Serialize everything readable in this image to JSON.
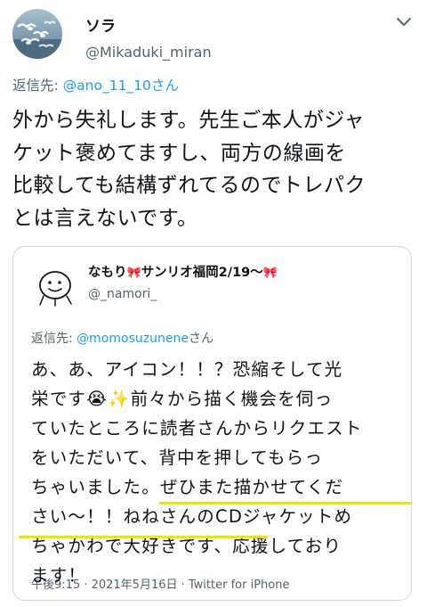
{
  "tweet": {
    "author": {
      "display_name": "ソラ",
      "handle": "@Mikaduki_miran",
      "avatar_icon": "seagulls-photo-avatar"
    },
    "more_icon": "chevron-down-icon",
    "reply": {
      "prefix": "返信先: ",
      "mention": "@ano_11_10",
      "suffix": "さん"
    },
    "text": "外から失礼します。先生ご本人がジャ\nケット褒めてますし、両方の線画を\n比較しても結構ずれてるのでトレパク\nとは言えないです。",
    "colors": {
      "link": "#1d9bf0",
      "secondary_text": "#536471",
      "highlight": "#f6e200"
    }
  },
  "quote": {
    "author": {
      "display_name_prefix": "なもり",
      "display_name_middle": "サンリオ福岡2/19〜",
      "bow_emoji": "🎀",
      "handle": "@_namori_",
      "avatar_icon": "smiley-doodle-avatar"
    },
    "reply": {
      "prefix": "返信先: ",
      "mention": "@momosuzunene",
      "suffix": "さん"
    },
    "text": "あ、あ、アイコン！！？恐縮そして光\n栄です😭✨前々から描く機会を伺っ\nていたところに読者さんからリクエスト\nをいただいて、背中を押してもらっ\nちゃいました。ぜひまた描かせてくだ\nさい〜！！ねねさんのCDジャケットめ\nちゃかわで大好きです、応援しており\nます！",
    "meta": "午後9:15 · 2021年5月16日 · Twitter for iPhone"
  }
}
